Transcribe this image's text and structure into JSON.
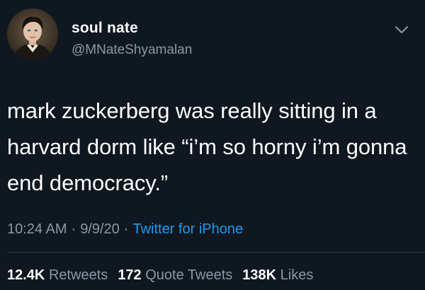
{
  "author": {
    "display_name": "soul nate",
    "handle": "@MNateShyamalan",
    "avatar_icon": "profile-portrait-icon"
  },
  "menu_icon": "chevron-down-icon",
  "tweet": {
    "text": "mark zuckerberg was really sitting in a harvard dorm like “i’m so horny i’m gonna end democracy.”"
  },
  "meta": {
    "time": "10:24 AM",
    "date": "9/9/20",
    "separator": "·",
    "source": "Twitter for iPhone"
  },
  "stats": {
    "retweets_count": "12.4K",
    "retweets_label": "Retweets",
    "quote_count": "172",
    "quote_label": "Quote Tweets",
    "likes_count": "138K",
    "likes_label": "Likes"
  },
  "colors": {
    "background": "#0f1720",
    "text_primary": "#ffffff",
    "text_secondary": "#8b98a5",
    "link": "#1d9bf0"
  }
}
